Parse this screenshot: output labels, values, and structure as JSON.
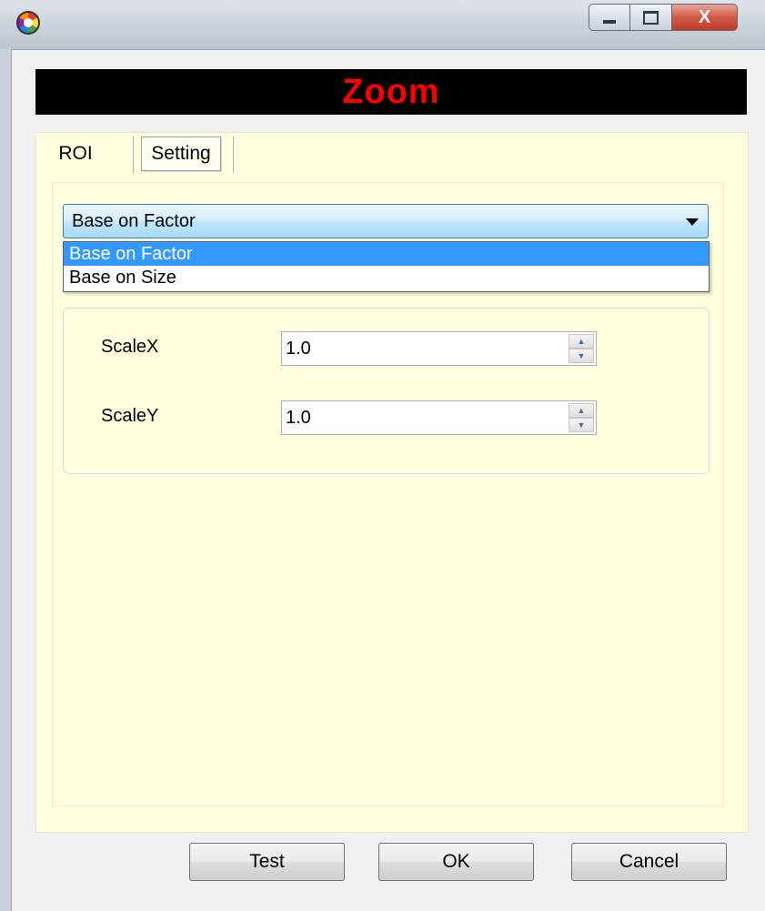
{
  "window": {
    "title": "",
    "controls": {
      "minimize": "minimize",
      "maximize": "maximize",
      "close": "X"
    }
  },
  "header": {
    "title": "Zoom",
    "title_color": "#ff0000",
    "background": "#000000"
  },
  "tabs": [
    {
      "label": "ROI",
      "active": false
    },
    {
      "label": "Setting",
      "active": true
    }
  ],
  "mode_combo": {
    "value": "Base on Factor",
    "options": [
      "Base on Factor",
      "Base on Size"
    ],
    "highlighted": "Base on Factor"
  },
  "scale": {
    "x": {
      "label": "ScaleX",
      "value": "1.0"
    },
    "y": {
      "label": "ScaleY",
      "value": "1.0"
    }
  },
  "buttons": {
    "test": "Test",
    "ok": "OK",
    "cancel": "Cancel"
  },
  "icons": {
    "app": "app-icon",
    "dropdown": "chevron-down-icon",
    "spin_up": "spin-up-icon",
    "spin_down": "spin-down-icon"
  }
}
